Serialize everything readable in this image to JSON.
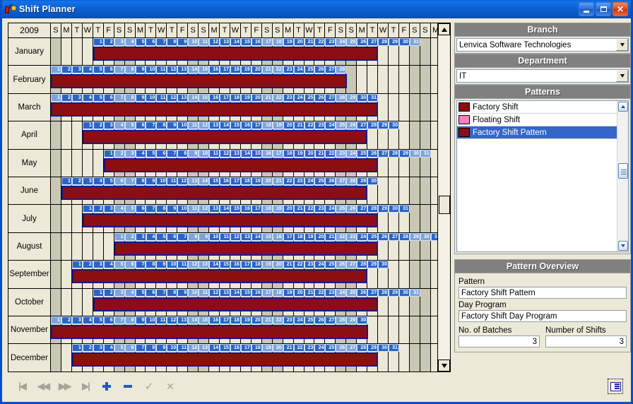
{
  "window": {
    "title": "Shift Planner",
    "icon": "shift-planner-icon",
    "buttons": {
      "minimize": "_",
      "maximize": "□",
      "close": "✕"
    }
  },
  "calendar": {
    "year_label": "2009",
    "weekday_sequence": [
      "S",
      "M",
      "T",
      "W",
      "T",
      "F",
      "S"
    ],
    "total_day_columns": 37,
    "weekend_indices": [
      0,
      6
    ],
    "months": [
      {
        "name": "January",
        "offset": 4,
        "days": 31,
        "bar_start": 4,
        "bar_end": 31
      },
      {
        "name": "February",
        "offset": 0,
        "days": 28,
        "bar_start": 0,
        "bar_end": 28
      },
      {
        "name": "March",
        "offset": 0,
        "days": 31,
        "bar_start": 0,
        "bar_end": 31
      },
      {
        "name": "April",
        "offset": 3,
        "days": 30,
        "bar_start": 3,
        "bar_end": 30
      },
      {
        "name": "May",
        "offset": 5,
        "days": 31,
        "bar_start": 5,
        "bar_end": 31
      },
      {
        "name": "June",
        "offset": 1,
        "days": 30,
        "bar_start": 1,
        "bar_end": 30
      },
      {
        "name": "July",
        "offset": 3,
        "days": 31,
        "bar_start": 3,
        "bar_end": 31
      },
      {
        "name": "August",
        "offset": 6,
        "days": 31,
        "bar_start": 6,
        "bar_end": 31
      },
      {
        "name": "September",
        "offset": 2,
        "days": 30,
        "bar_start": 2,
        "bar_end": 30
      },
      {
        "name": "October",
        "offset": 4,
        "days": 31,
        "bar_start": 4,
        "bar_end": 31
      },
      {
        "name": "November",
        "offset": 0,
        "days": 30,
        "bar_start": 0,
        "bar_end": 30
      },
      {
        "name": "December",
        "offset": 2,
        "days": 31,
        "bar_start": 2,
        "bar_end": 31
      }
    ],
    "scrollbar": {
      "up": "▲",
      "down": "▼"
    }
  },
  "branch": {
    "caption": "Branch",
    "value": "Lenvica Software Technologies"
  },
  "department": {
    "caption": "Department",
    "value": "IT"
  },
  "patterns": {
    "caption": "Patterns",
    "items": [
      {
        "label": "Factory Shift",
        "color": "#8b0f12",
        "selected": false
      },
      {
        "label": "Floating Shift",
        "color": "#ff7fbf",
        "selected": false
      },
      {
        "label": "Factory Shift Pattern",
        "color": "#8b0f12",
        "selected": true
      }
    ]
  },
  "overview": {
    "caption": "Pattern Overview",
    "pattern_label": "Pattern",
    "pattern_value": "Factory Shift Pattern",
    "day_program_label": "Day Program",
    "day_program_value": "Factory Shift Day Program",
    "batches_label": "No. of Batches",
    "batches_value": "3",
    "shifts_label": "Number of Shifts",
    "shifts_value": "3"
  },
  "toolbar": {
    "first": "|◀",
    "prev": "◀◀",
    "next": "▶▶",
    "last": "▶|",
    "add": "+",
    "remove": "−",
    "accept": "✓",
    "cancel": "✕",
    "view": "list-view-icon"
  },
  "colors": {
    "bar_fill": "#8b0f12",
    "bar_border": "#151a8c",
    "chip": "#2a64c8",
    "selection": "#3465c8",
    "caption_bar": "#808080",
    "face": "#ece9d8"
  }
}
